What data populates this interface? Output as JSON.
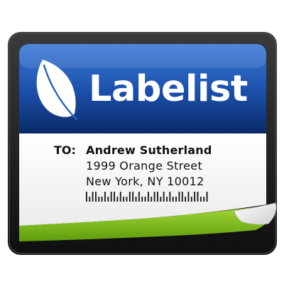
{
  "app": {
    "name": "Labelist",
    "logo_icon": "leaf-icon"
  },
  "label": {
    "to_label": "TO:",
    "recipient_name": "Andrew Sutherland",
    "street": "1999 Orange Street",
    "city_line": "New York, NY 10012",
    "barcode_icon": "postal-barcode-icon"
  },
  "colors": {
    "header_top": "#2f6fd0",
    "header_bottom": "#0b2a66",
    "frame_dark": "#1b1b1b",
    "curl_green": "#7fc31c",
    "paper": "#ffffff"
  }
}
